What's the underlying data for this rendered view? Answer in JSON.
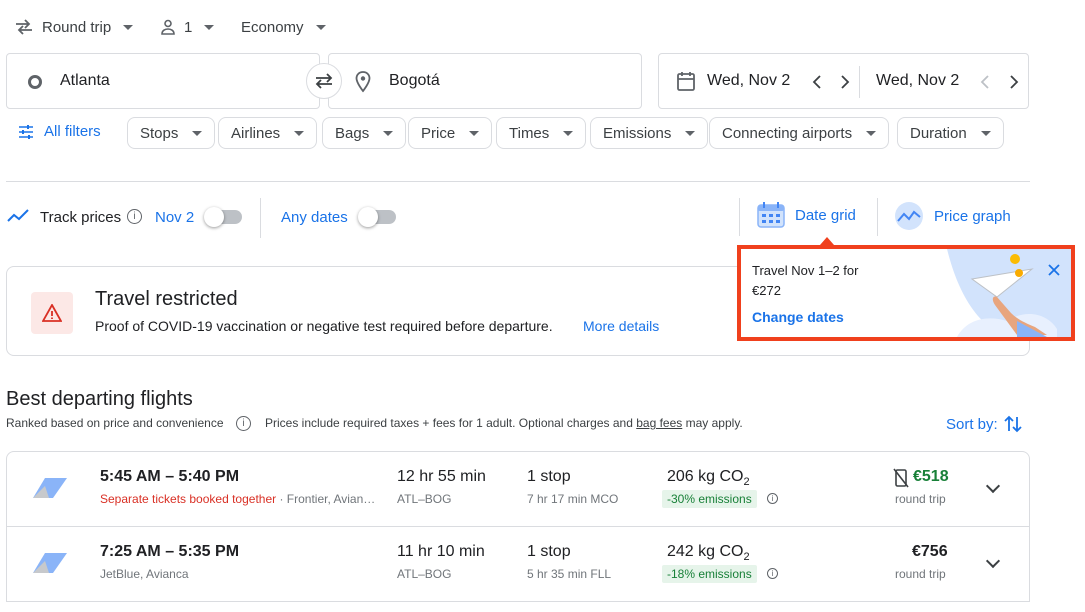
{
  "trip": {
    "type_label": "Round trip",
    "passengers": "1",
    "cabin": "Economy"
  },
  "search": {
    "origin": "Atlanta",
    "destination": "Bogotá",
    "depart_date": "Wed, Nov 2",
    "return_date": "Wed, Nov 2"
  },
  "filters": {
    "all_filters": "All filters",
    "chips": [
      "Stops",
      "Airlines",
      "Bags",
      "Price",
      "Times",
      "Emissions",
      "Connecting airports",
      "Duration"
    ]
  },
  "tracking": {
    "track_label": "Track prices",
    "date_label": "Nov 2",
    "any_dates": "Any dates",
    "date_grid": "Date grid",
    "price_graph": "Price graph"
  },
  "popup": {
    "line1": "Travel Nov 1–2 for",
    "line2": "€272",
    "action": "Change dates"
  },
  "banner": {
    "title": "Travel restricted",
    "text": "Proof of COVID-19 vaccination or negative test required before departure.",
    "link": "More details"
  },
  "results": {
    "heading": "Best departing flights",
    "ranked": "Ranked based on price and convenience",
    "prices_note_a": "Prices include required taxes + fees for 1 adult. Optional charges and",
    "prices_note_link": "bag fees",
    "prices_note_b": "may apply.",
    "sort_label": "Sort by:"
  },
  "flights": [
    {
      "times": "5:45 AM – 5:40 PM",
      "warning": "Separate tickets booked together",
      "airlines": " · Frontier, Avian…",
      "duration": "12 hr 55 min",
      "route": "ATL–BOG",
      "stops": "1 stop",
      "layover": "7 hr 17 min MCO",
      "co2": "206 kg CO",
      "co2_sub": "2",
      "emissions": "-30% emissions",
      "price": "€518",
      "price_color": "#188038",
      "price_sub": "round trip"
    },
    {
      "times": "7:25 AM – 5:35 PM",
      "airlines": "JetBlue, Avianca",
      "duration": "11 hr 10 min",
      "route": "ATL–BOG",
      "stops": "1 stop",
      "layover": "5 hr 35 min FLL",
      "co2": "242 kg CO",
      "co2_sub": "2",
      "emissions": "-18% emissions",
      "price": "€756",
      "price_color": "#202124",
      "price_sub": "round trip"
    }
  ],
  "colors": {
    "accent": "#1a73e8",
    "highlight_border": "#f0401d",
    "warning_red": "#d93025",
    "eco_green": "#188038"
  }
}
